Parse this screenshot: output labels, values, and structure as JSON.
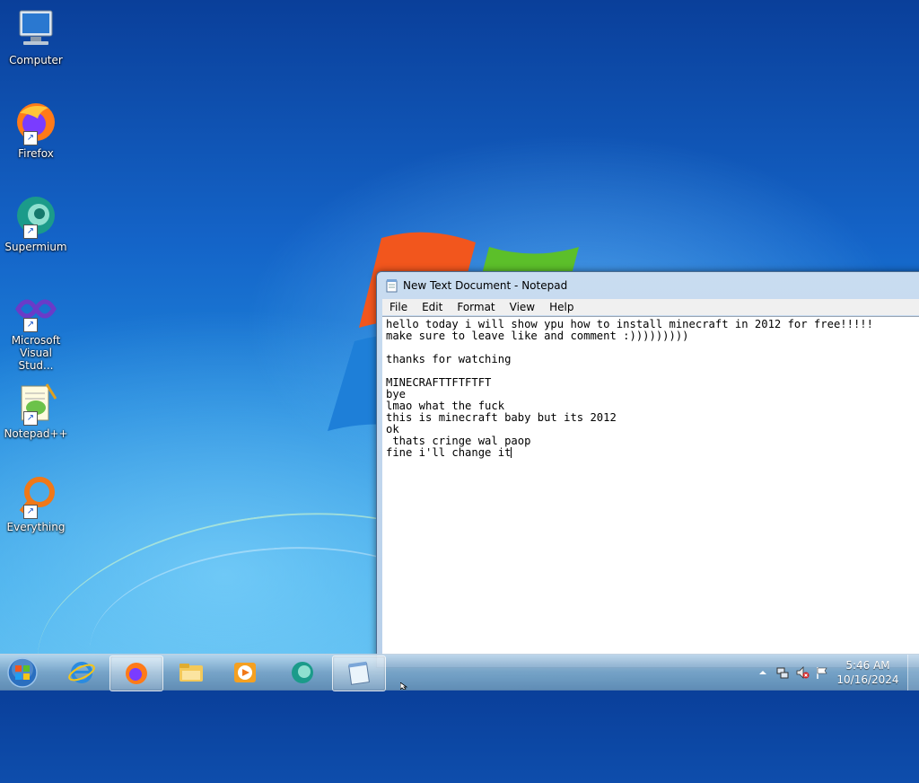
{
  "desktop": {
    "icons": [
      {
        "label": "Computer"
      },
      {
        "label": "Firefox"
      },
      {
        "label": "Supermium"
      },
      {
        "label": "Microsoft Visual Stud..."
      },
      {
        "label": "Notepad++"
      },
      {
        "label": "Everything"
      }
    ]
  },
  "notepad": {
    "title": "New Text Document - Notepad",
    "menu": [
      "File",
      "Edit",
      "Format",
      "View",
      "Help"
    ],
    "lines": [
      "hello today i will show ypu how to install minecraft in 2012 for free!!!!!",
      "make sure to leave like and comment :)))))))))",
      "",
      "thanks for watching",
      "",
      "MINECRAFTTFTFTFT",
      "bye",
      "lmao what the fuck",
      "this is minecraft baby but its 2012",
      "ok",
      " thats cringe wal paop",
      "fine i'll change it"
    ]
  },
  "taskbar": {
    "buttons": [
      "start-orb-icon",
      "internet-explorer-icon",
      "firefox-icon",
      "file-explorer-icon",
      "media-player-icon",
      "supermium-icon",
      "notepad-icon"
    ],
    "active_buttons": [
      "firefox-icon",
      "notepad-icon"
    ],
    "clock": {
      "time": "5:46 AM",
      "date": "10/16/2024"
    }
  }
}
